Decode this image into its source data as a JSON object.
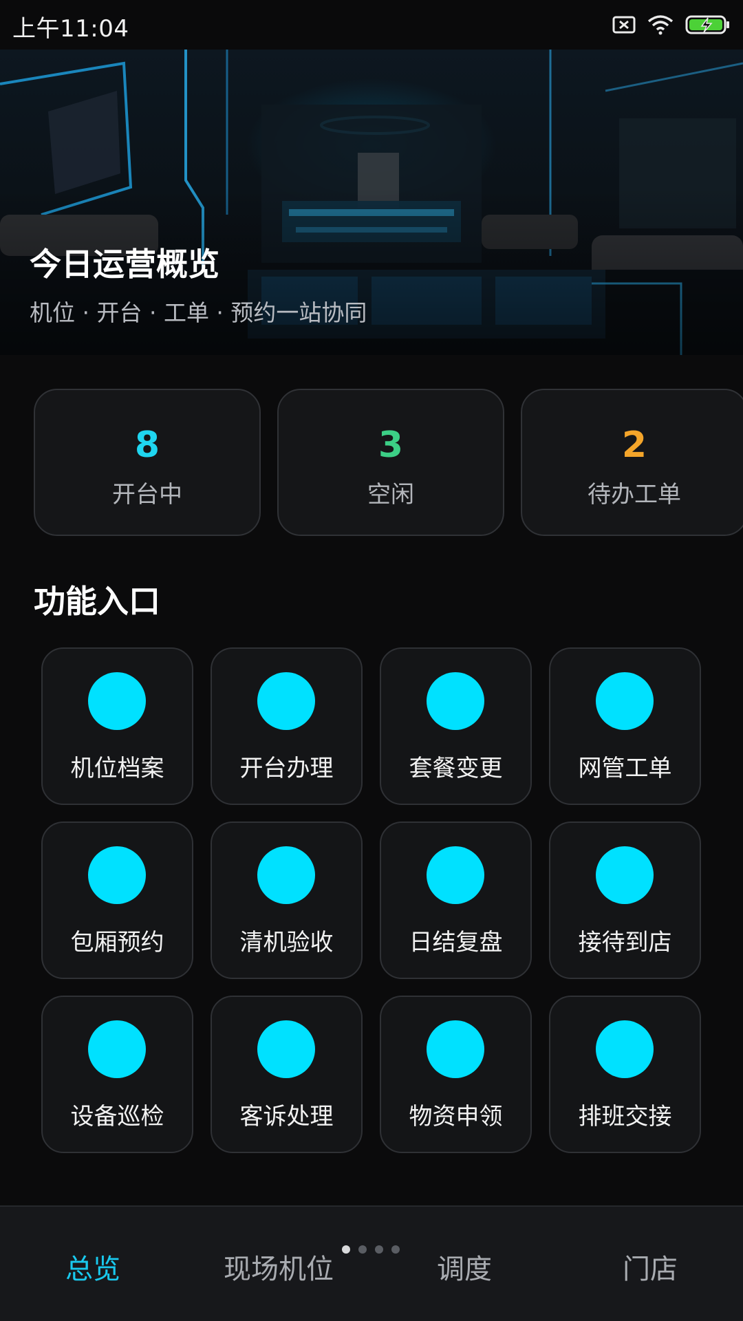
{
  "status_bar": {
    "time": "上午11:04",
    "icons": [
      "sim-error-icon",
      "wifi-icon",
      "battery-charging-icon"
    ]
  },
  "hero": {
    "title": "今日运营概览",
    "subtitle": "机位 · 开台 · 工单 · 预约一站协同"
  },
  "stats": [
    {
      "value": "8",
      "label": "开台中",
      "color": "#1fd6f0"
    },
    {
      "value": "3",
      "label": "空闲",
      "color": "#3ccf86"
    },
    {
      "value": "2",
      "label": "待办工单",
      "color": "#f4a52a"
    }
  ],
  "functions": {
    "title": "功能入口",
    "icon_color": "#00e1ff",
    "items": [
      {
        "label": "机位档案"
      },
      {
        "label": "开台办理"
      },
      {
        "label": "套餐变更"
      },
      {
        "label": "网管工单"
      },
      {
        "label": "包厢预约"
      },
      {
        "label": "清机验收"
      },
      {
        "label": "日结复盘"
      },
      {
        "label": "接待到店"
      },
      {
        "label": "设备巡检"
      },
      {
        "label": "客诉处理"
      },
      {
        "label": "物资申领"
      },
      {
        "label": "排班交接"
      }
    ]
  },
  "bottom_nav": {
    "items": [
      {
        "label": "总览",
        "active": true
      },
      {
        "label": "现场机位",
        "active": false
      },
      {
        "label": "调度",
        "active": false
      },
      {
        "label": "门店",
        "active": false
      }
    ],
    "page_count": 4,
    "current_page": 1,
    "active_color": "#19c9ee"
  }
}
